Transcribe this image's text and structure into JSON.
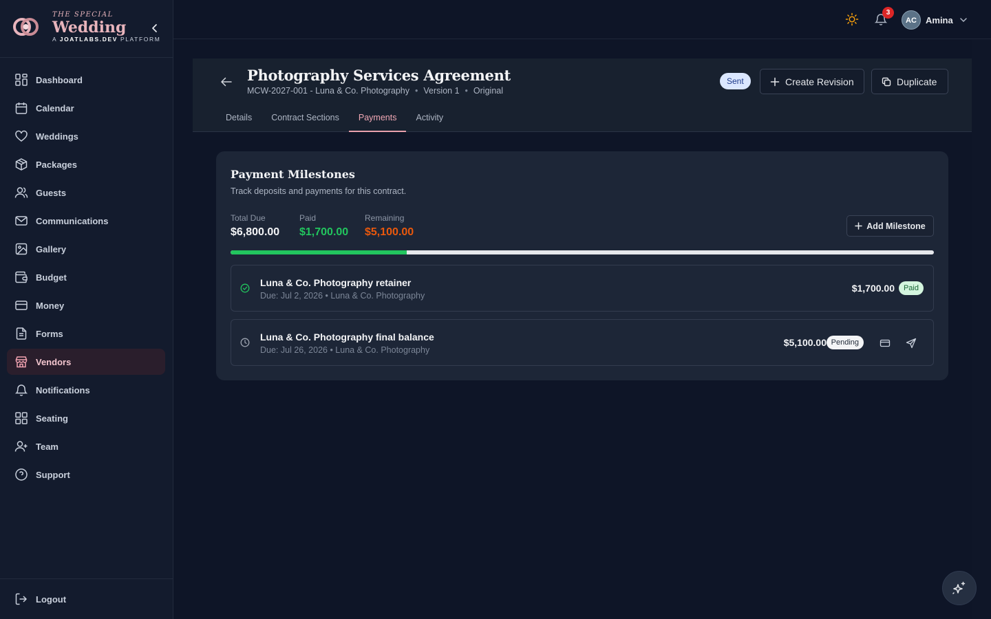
{
  "brand": {
    "top": "THE SPECIAL",
    "main": "Wedding",
    "sub_prefix": "A ",
    "sub_strong": "JOATLABS.DEV",
    "sub_suffix": " PLATFORM"
  },
  "sidebar": {
    "items": [
      {
        "label": "Dashboard",
        "icon": "dashboard-icon"
      },
      {
        "label": "Calendar",
        "icon": "calendar-icon"
      },
      {
        "label": "Weddings",
        "icon": "heart-icon"
      },
      {
        "label": "Packages",
        "icon": "package-icon"
      },
      {
        "label": "Guests",
        "icon": "users-icon"
      },
      {
        "label": "Communications",
        "icon": "mail-icon"
      },
      {
        "label": "Gallery",
        "icon": "image-icon"
      },
      {
        "label": "Budget",
        "icon": "wallet-icon"
      },
      {
        "label": "Money",
        "icon": "credit-card-icon"
      },
      {
        "label": "Forms",
        "icon": "file-icon"
      },
      {
        "label": "Vendors",
        "icon": "store-icon",
        "active": true
      },
      {
        "label": "Notifications",
        "icon": "bell-icon"
      },
      {
        "label": "Seating",
        "icon": "grid-icon"
      },
      {
        "label": "Team",
        "icon": "user-plus-icon"
      },
      {
        "label": "Support",
        "icon": "help-icon"
      }
    ],
    "logout": "Logout"
  },
  "topbar": {
    "notification_count": "3",
    "user_initials": "AC",
    "user_name": "Amina"
  },
  "contract": {
    "title": "Photography Services Agreement",
    "code": "MCW-2027-001 - Luna & Co. Photography",
    "version": "Version 1",
    "type": "Original",
    "status": "Sent",
    "create_revision": "Create Revision",
    "duplicate": "Duplicate",
    "tabs": [
      "Details",
      "Contract Sections",
      "Payments",
      "Activity"
    ],
    "active_tab": "Payments"
  },
  "payments": {
    "title": "Payment Milestones",
    "description": "Track deposits and payments for this contract.",
    "total_label": "Total Due",
    "total_value": "$6,800.00",
    "paid_label": "Paid",
    "paid_value": "$1,700.00",
    "remaining_label": "Remaining",
    "remaining_value": "$5,100.00",
    "add_milestone": "Add Milestone",
    "progress_fraction": 0.25,
    "milestones": [
      {
        "name": "Luna & Co. Photography retainer",
        "meta": "Due: Jul 2, 2026 • Luna & Co. Photography",
        "amount": "$1,700.00",
        "status": "Paid"
      },
      {
        "name": "Luna & Co. Photography final balance",
        "meta": "Due: Jul 26, 2026 • Luna & Co. Photography",
        "amount": "$5,100.00",
        "status": "Pending"
      }
    ]
  },
  "colors": {
    "accent": "#e8a0ad",
    "paid": "#22c55e",
    "remaining": "#ea580c",
    "background": "#0e1527"
  }
}
